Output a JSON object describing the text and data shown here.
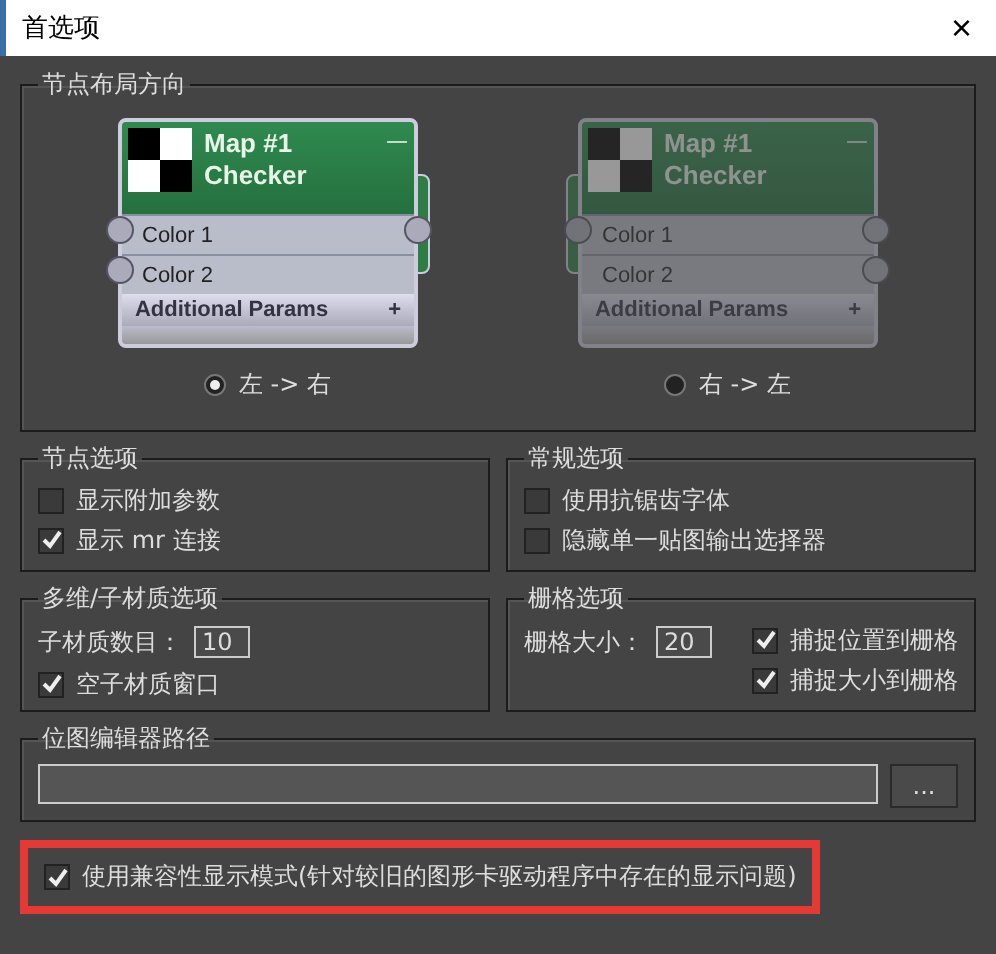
{
  "window": {
    "title": "首选项",
    "close": "×"
  },
  "layout_direction": {
    "title": "节点布局方向",
    "options": [
      {
        "label": "左 -> 右",
        "selected": true,
        "node": {
          "title": "Map #1",
          "subtitle": "Checker",
          "collapse": "—",
          "slots": [
            "Color 1",
            "Color 2"
          ],
          "footer": "Additional Params",
          "footer_icon": "+"
        }
      },
      {
        "label": "右 -> 左",
        "selected": false,
        "node": {
          "title": "Map #1",
          "subtitle": "Checker",
          "collapse": "—",
          "slots": [
            "Color 1",
            "Color 2"
          ],
          "footer": "Additional Params",
          "footer_icon": "+"
        }
      }
    ]
  },
  "node_options": {
    "title": "节点选项",
    "items": [
      {
        "label": "显示附加参数",
        "checked": false
      },
      {
        "label": "显示 mr 连接",
        "checked": true
      }
    ]
  },
  "general_options": {
    "title": "常规选项",
    "items": [
      {
        "label": "使用抗锯齿字体",
        "checked": false
      },
      {
        "label": "隐藏单一贴图输出选择器",
        "checked": false
      }
    ]
  },
  "multi_sub_options": {
    "title": "多维/子材质选项",
    "count_label": "子材质数目：",
    "count_value": "10",
    "items": [
      {
        "label": "空子材质窗口",
        "checked": true
      }
    ]
  },
  "grid_options": {
    "title": "栅格选项",
    "size_label": "栅格大小：",
    "size_value": "20",
    "items": [
      {
        "label": "捕捉位置到栅格",
        "checked": true
      },
      {
        "label": "捕捉大小到栅格",
        "checked": true
      }
    ]
  },
  "bitmap_editor_path": {
    "title": "位图编辑器路径",
    "browse": "..."
  },
  "compat_mode": {
    "label": "使用兼容性显示模式(针对较旧的图形卡驱动程序中存在的显示问题)",
    "checked": true,
    "highlighted": true
  }
}
